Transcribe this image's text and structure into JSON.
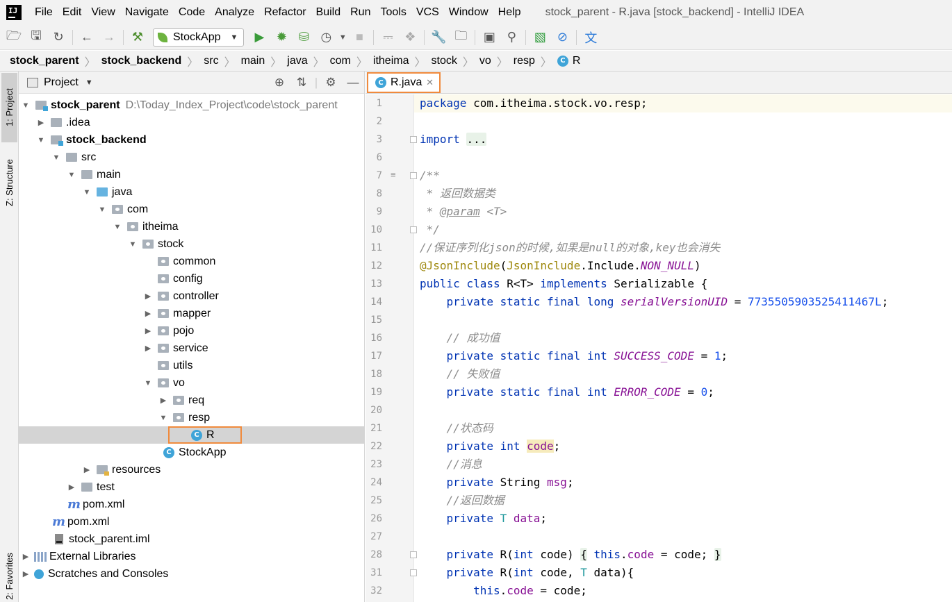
{
  "app": {
    "menu": [
      "File",
      "Edit",
      "View",
      "Navigate",
      "Code",
      "Analyze",
      "Refactor",
      "Build",
      "Run",
      "Tools",
      "VCS",
      "Window",
      "Help"
    ],
    "window_title": "stock_parent - R.java [stock_backend] - IntelliJ IDEA"
  },
  "toolbar": {
    "run_config": "StockApp"
  },
  "breadcrumb": [
    "stock_parent",
    "stock_backend",
    "src",
    "main",
    "java",
    "com",
    "itheima",
    "stock",
    "vo",
    "resp",
    "R"
  ],
  "left_strip": {
    "project_tab": "1: Project",
    "structure_tab": "Z: Structure",
    "favorites_tab": "2: Favorites"
  },
  "project_panel": {
    "title": "Project",
    "tree": [
      {
        "label": "stock_parent",
        "path": "D:\\Today_Index_Project\\code\\stock_parent"
      },
      {
        "label": ".idea"
      },
      {
        "label": "stock_backend"
      },
      {
        "label": "src"
      },
      {
        "label": "main"
      },
      {
        "label": "java"
      },
      {
        "label": "com"
      },
      {
        "label": "itheima"
      },
      {
        "label": "stock"
      },
      {
        "label": "common"
      },
      {
        "label": "config"
      },
      {
        "label": "controller"
      },
      {
        "label": "mapper"
      },
      {
        "label": "pojo"
      },
      {
        "label": "service"
      },
      {
        "label": "utils"
      },
      {
        "label": "vo"
      },
      {
        "label": "req"
      },
      {
        "label": "resp"
      },
      {
        "label": "R"
      },
      {
        "label": "StockApp"
      },
      {
        "label": "resources"
      },
      {
        "label": "test"
      },
      {
        "label": "pom.xml"
      },
      {
        "label": "pom.xml"
      },
      {
        "label": "stock_parent.iml"
      },
      {
        "label": "External Libraries"
      },
      {
        "label": "Scratches and Consoles"
      }
    ]
  },
  "editor": {
    "tab_label": "R.java",
    "line_numbers": [
      "1",
      "2",
      "3",
      "6",
      "7",
      "8",
      "9",
      "10",
      "11",
      "12",
      "13",
      "14",
      "15",
      "16",
      "17",
      "18",
      "19",
      "20",
      "21",
      "22",
      "23",
      "24",
      "25",
      "26",
      "27",
      "28",
      "31",
      "32"
    ],
    "code": {
      "l1_kw": "package",
      "l1_rest": " com.itheima.stock.vo.resp;",
      "l3_kw": "import",
      "l3_fold": "...",
      "l7": "/**",
      "l8": " * 返回数据类",
      "l9_pre": " * ",
      "l9_tag": "@param",
      "l9_rest": " <T>",
      "l10": " */",
      "l11": "//保证序列化json的时候,如果是null的对象,key也会消失",
      "l12_ann": "@JsonInclude",
      "l12_a": "(",
      "l12_b": "JsonInclude",
      "l12_c": ".Include.",
      "l12_d": "NON_NULL",
      "l12_e": ")",
      "l13_kw1": "public class",
      "l13_name": " R",
      "l13_t": "<T>",
      "l13_kw2": " implements",
      "l13_rest": " Serializable {",
      "l14_kw": "    private static final long",
      "l14_fld": " serialVersionUID",
      "l14_eq": " = ",
      "l14_num": "7735505903525411467L",
      "l14_end": ";",
      "l16": "    // 成功值",
      "l17_kw": "    private static final int",
      "l17_fld": " SUCCESS_CODE",
      "l17_eq": " = ",
      "l17_num": "1",
      "l17_end": ";",
      "l18": "    // 失败值",
      "l19_kw": "    private static final int",
      "l19_fld": " ERROR_CODE",
      "l19_eq": " = ",
      "l19_num": "0",
      "l19_end": ";",
      "l21": "    //状态码",
      "l22_kw": "    private int",
      "l22_fld": "code",
      "l22_end": ";",
      "l23": "    //消息",
      "l24_kw": "    private",
      "l24_type": " String",
      "l24_fld": " msg",
      "l24_end": ";",
      "l25": "    //返回数据",
      "l26_kw": "    private",
      "l26_t": " T",
      "l26_fld": " data",
      "l26_end": ";",
      "l28_kw": "    private",
      "l28_name": " R",
      "l28_a": "(",
      "l28_kw2": "int",
      "l28_b": " code) ",
      "l28_fold_open": "{",
      "l28_kw3": " this",
      "l28_c": ".",
      "l28_fld": "code",
      "l28_d": " = code; ",
      "l28_fold_close": "}",
      "l31_kw": "    private",
      "l31_name": " R",
      "l31_a": "(",
      "l31_kw2": "int",
      "l31_b": " code, ",
      "l31_t": "T",
      "l31_c": " data){",
      "l32_kw": "        this",
      "l32_a": ".",
      "l32_fld": "code",
      "l32_b": " = code;"
    }
  }
}
